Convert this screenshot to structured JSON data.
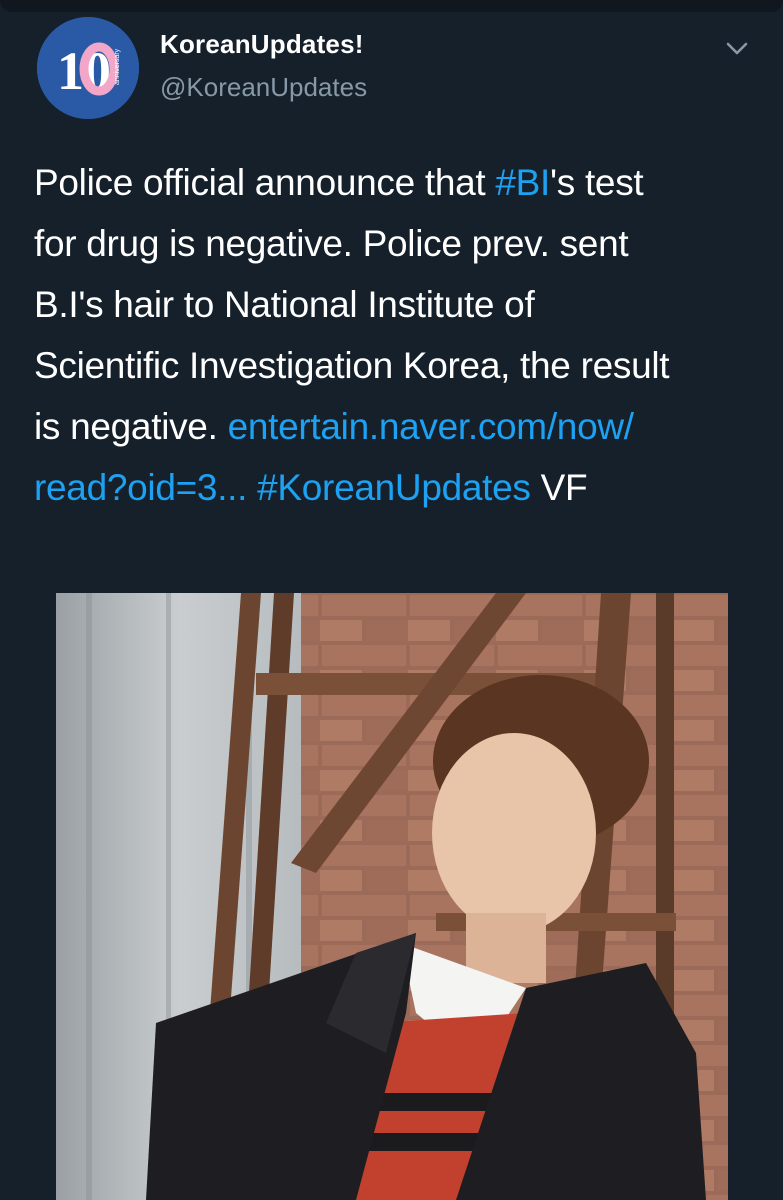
{
  "account": {
    "display_name": "KoreanUpdates!",
    "handle": "@KoreanUpdates",
    "avatar": {
      "big_text": "10",
      "small_text": "anniversary",
      "bg_color": "#2a5aa5",
      "accent_color": "#f2a6c8"
    }
  },
  "tweet": {
    "lines": [
      [
        {
          "text": "Police official announce that ",
          "link": false
        },
        {
          "text": "#BI",
          "link": true
        },
        {
          "text": "'s test",
          "link": false
        }
      ],
      [
        {
          "text": "for drug is negative. Police prev. sent",
          "link": false
        }
      ],
      [
        {
          "text": "B.I's hair to National Institute of",
          "link": false
        }
      ],
      [
        {
          "text": "Scientific Investigation Korea, the result",
          "link": false
        }
      ],
      [
        {
          "text": "is negative. ",
          "link": false
        },
        {
          "text": "entertain.naver.com/now/",
          "link": true
        }
      ],
      [
        {
          "text": "read?oid=3...",
          "link": true
        },
        {
          "text": " ",
          "link": false
        },
        {
          "text": "#KoreanUpdates",
          "link": true
        },
        {
          "text": " VF",
          "link": false
        }
      ]
    ]
  },
  "icons": {
    "menu": "chevron-down-icon"
  },
  "colors": {
    "background": "#15202b",
    "link": "#1da1f2",
    "secondary_text": "#8899a6",
    "primary_text": "#ffffff"
  }
}
